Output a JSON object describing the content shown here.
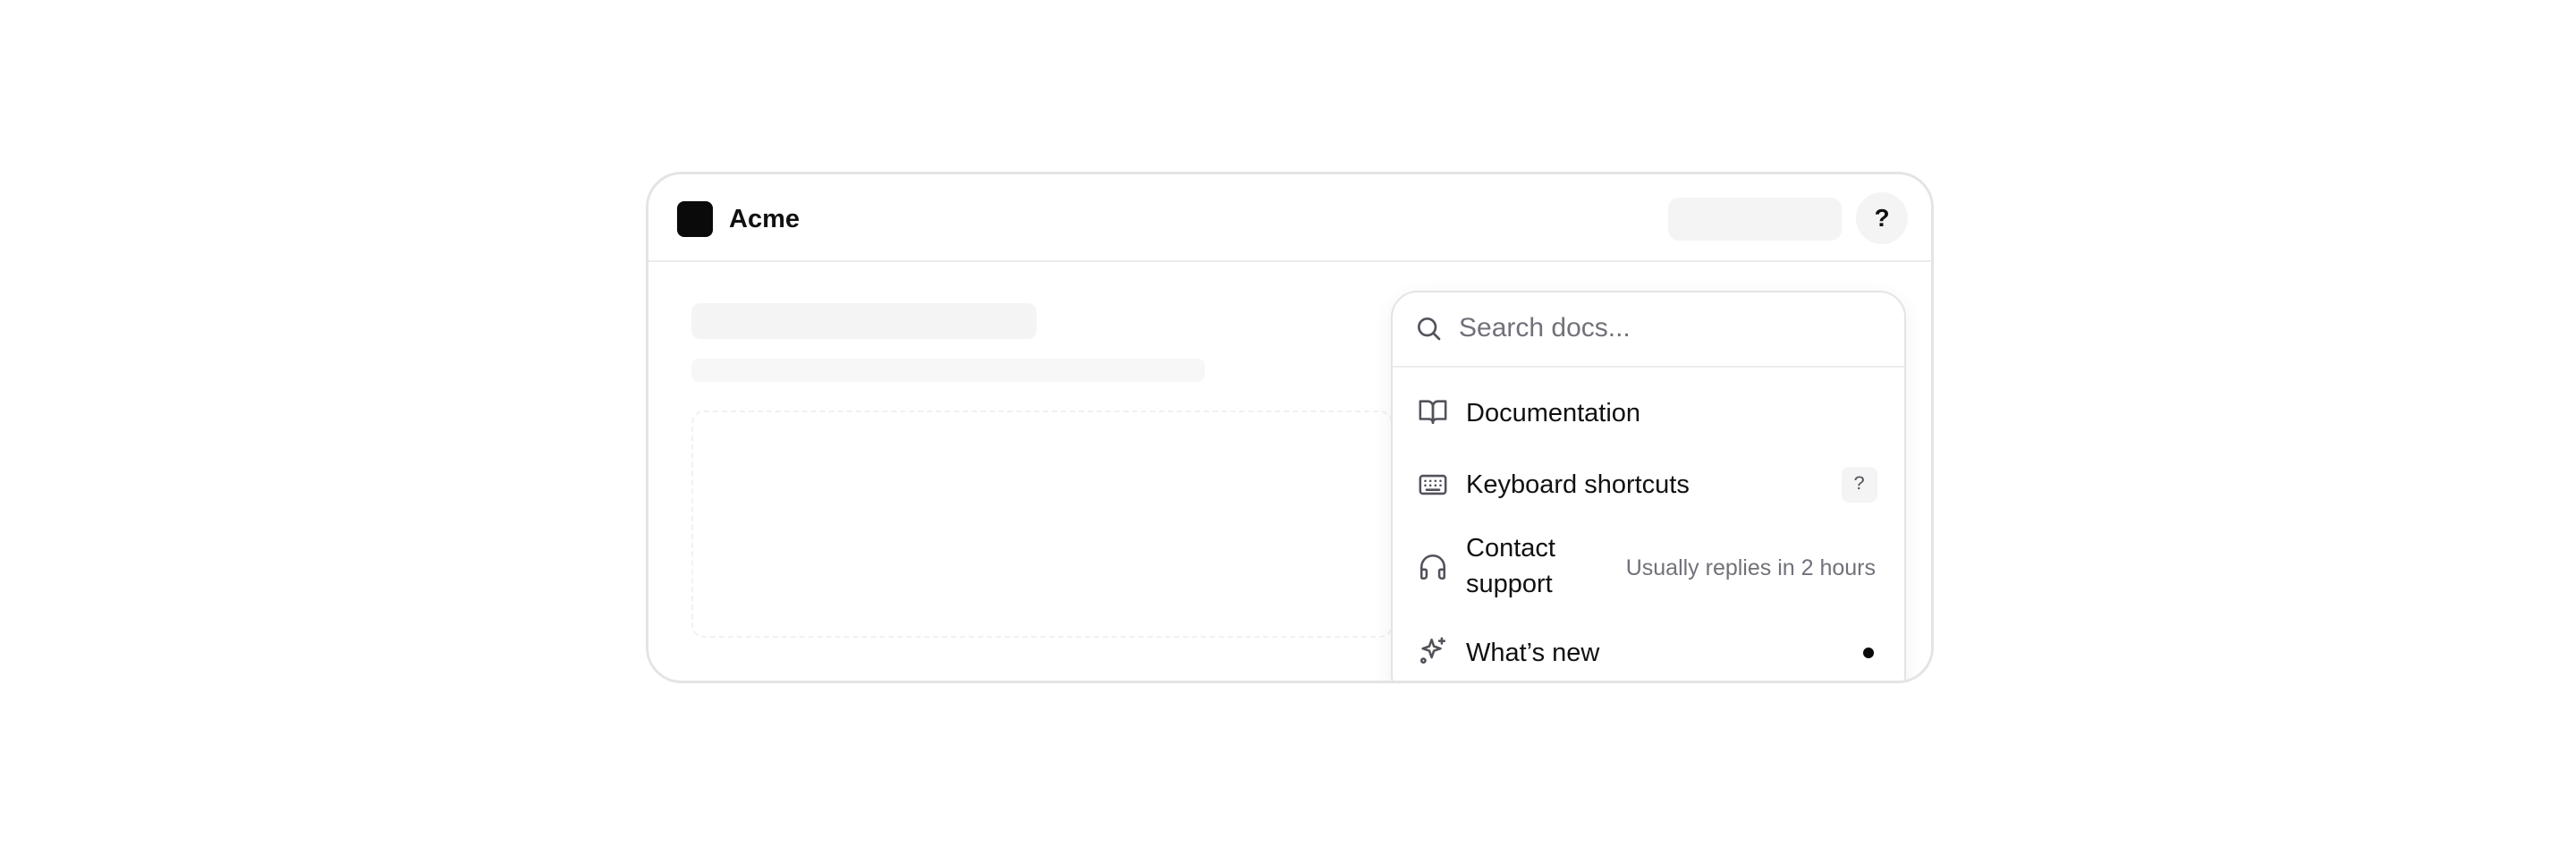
{
  "app": {
    "brand": "Acme",
    "help_glyph": "?"
  },
  "help_menu": {
    "search_placeholder": "Search docs...",
    "items": [
      {
        "label": "Documentation",
        "icon": "book-open-icon"
      },
      {
        "label": "Keyboard shortcuts",
        "icon": "keyboard-icon",
        "shortcut": "?"
      },
      {
        "label": "Contact\nsupport",
        "icon": "headphones-icon",
        "hint": "Usually replies in 2 hours"
      },
      {
        "label": "What’s new",
        "icon": "sparkles-icon",
        "badge": "unread-dot"
      }
    ]
  },
  "colors": {
    "accent": "#0a0a0a",
    "border": "#e4e4e7",
    "muted_text": "#71717a",
    "skeleton": "#f4f4f5"
  }
}
